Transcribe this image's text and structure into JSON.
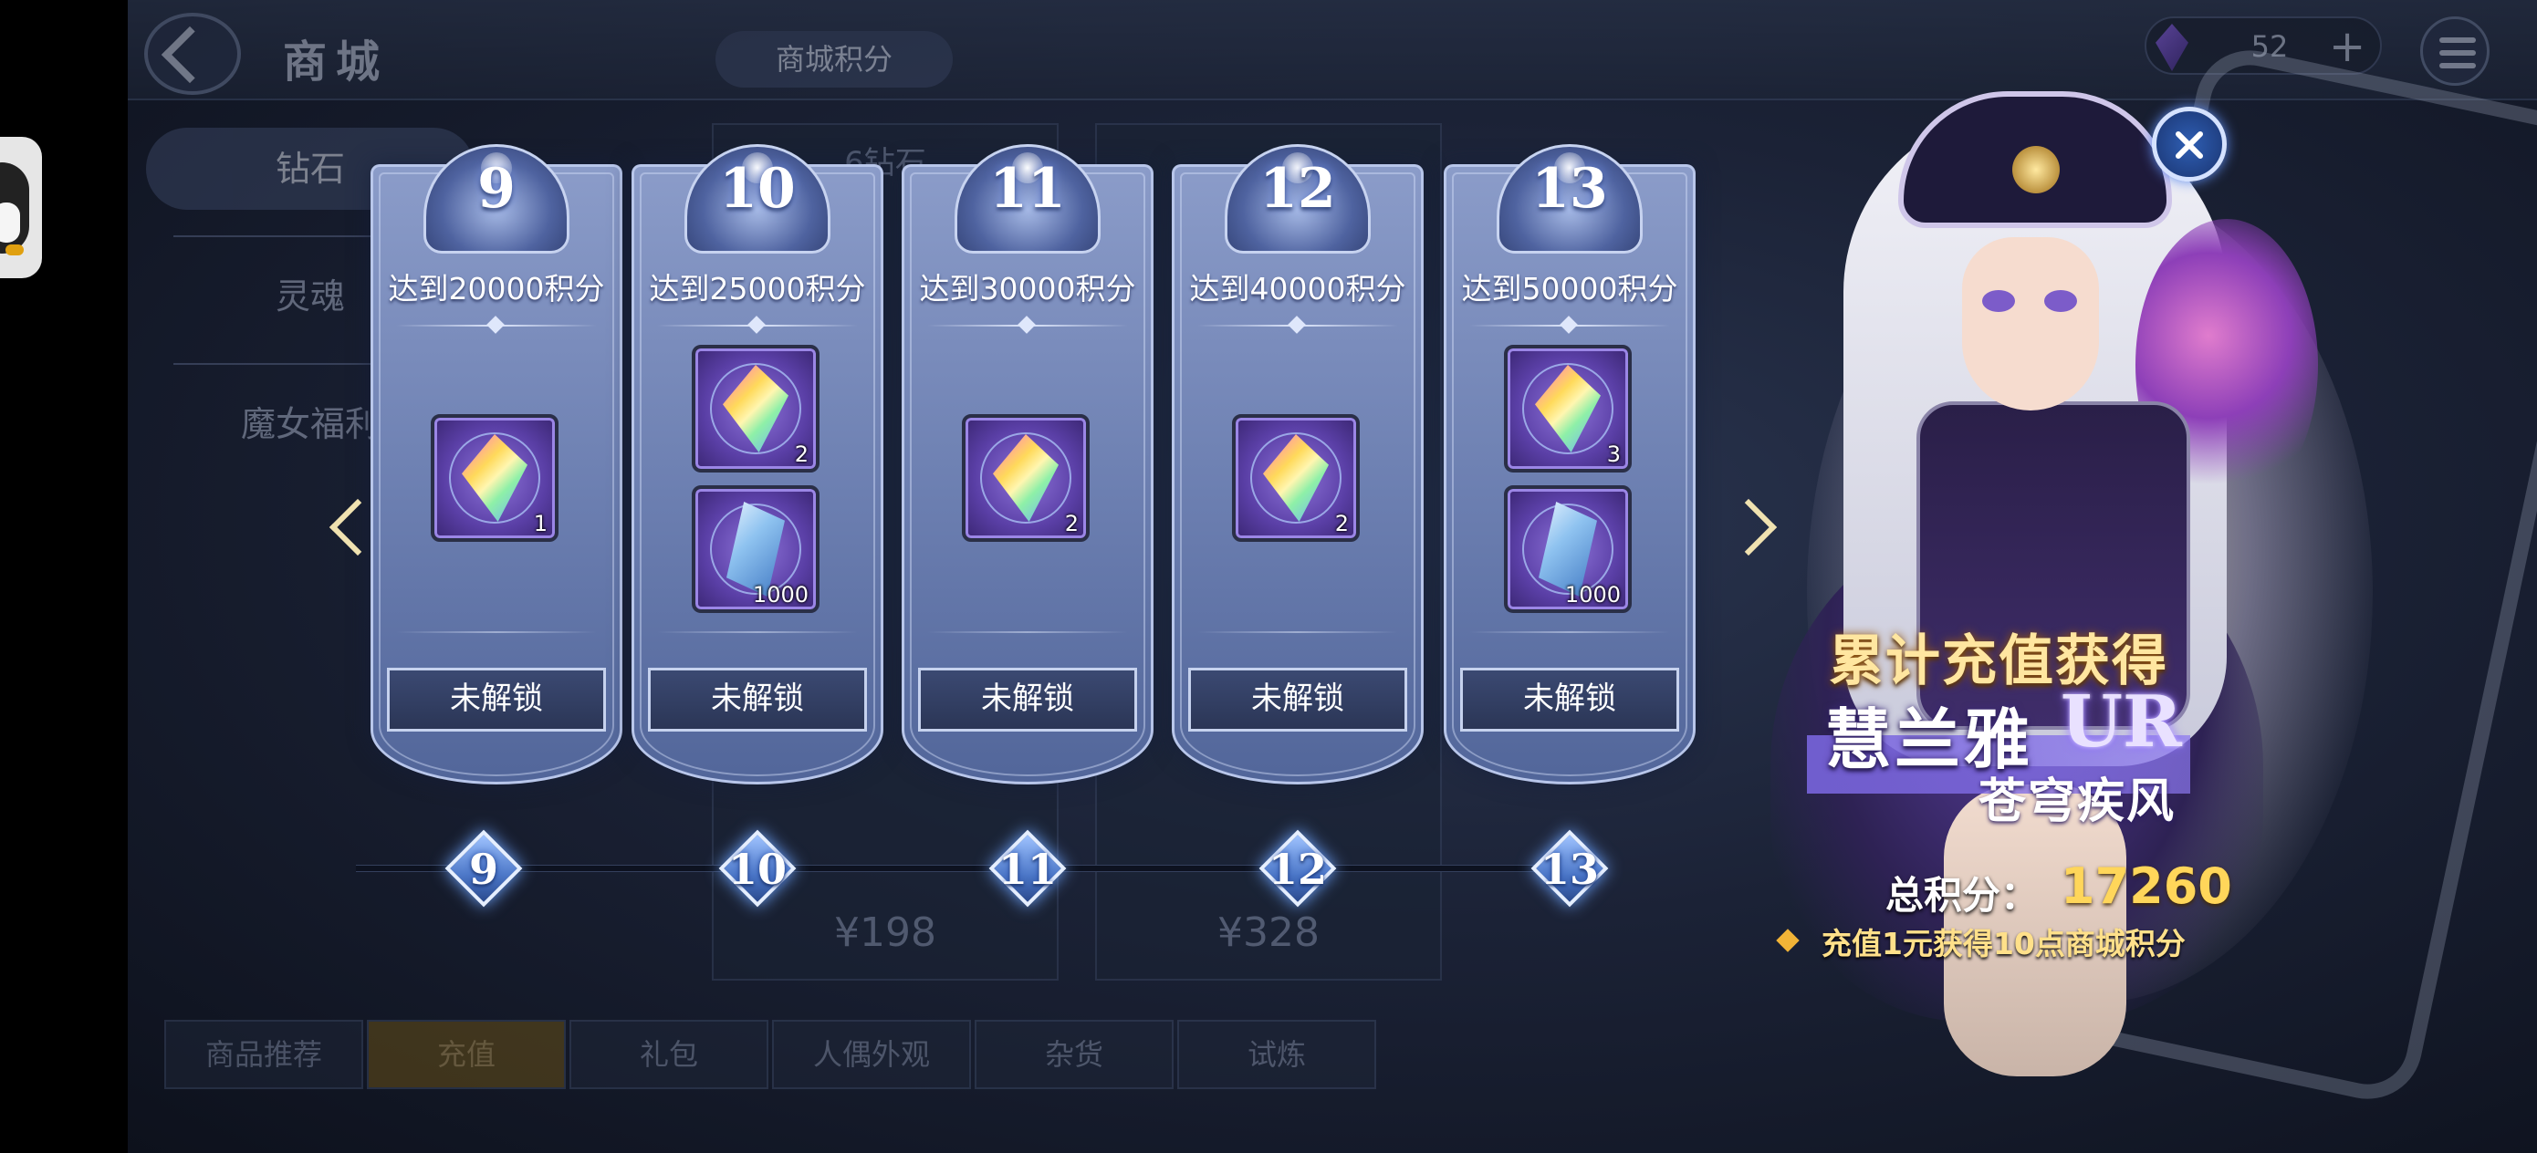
{
  "shop": {
    "title": "商城",
    "points_tab": "商城积分",
    "currency_value": "52",
    "currency_plus": "+",
    "side_nav": [
      "钻石",
      "灵魂",
      "魔女福利"
    ],
    "bg_cards": [
      {
        "title": "6钻石",
        "price": "¥198"
      },
      {
        "title": "",
        "price": "¥328"
      }
    ],
    "bottom_tabs": [
      "商品推荐",
      "充值",
      "礼包",
      "人偶外观",
      "杂货",
      "试炼"
    ]
  },
  "reward_panel": {
    "cards": [
      {
        "num": "9",
        "requirement": "达到20000积分",
        "items": [
          {
            "type": "rainbow-crystal",
            "count": "1"
          }
        ],
        "status": "未解锁"
      },
      {
        "num": "10",
        "requirement": "达到25000积分",
        "items": [
          {
            "type": "rainbow-crystal",
            "count": "2"
          },
          {
            "type": "blue-crystal",
            "count": "1000"
          }
        ],
        "status": "未解锁"
      },
      {
        "num": "11",
        "requirement": "达到30000积分",
        "items": [
          {
            "type": "rainbow-crystal",
            "count": "2"
          }
        ],
        "status": "未解锁"
      },
      {
        "num": "12",
        "requirement": "达到40000积分",
        "items": [
          {
            "type": "rainbow-crystal",
            "count": "2"
          }
        ],
        "status": "未解锁"
      },
      {
        "num": "13",
        "requirement": "达到50000积分",
        "items": [
          {
            "type": "rainbow-crystal",
            "count": "3"
          },
          {
            "type": "blue-crystal",
            "count": "1000"
          }
        ],
        "status": "未解锁"
      }
    ],
    "track_nodes": [
      "9",
      "10",
      "11",
      "12",
      "13"
    ]
  },
  "promo": {
    "title": "累计充值获得",
    "character_name": "慧兰雅",
    "rarity": "UR",
    "subtitle": "苍穹疾风",
    "total_label": "总积分：",
    "total_value": "17260",
    "rule": "充值1元获得10点商城积分"
  },
  "colors": {
    "card_top": "#8b9cc9",
    "card_bottom": "#52669a",
    "points_gold": "#ffd65a",
    "promo_gold": "#ffe6a0",
    "locked_btn": "#2b3656"
  }
}
